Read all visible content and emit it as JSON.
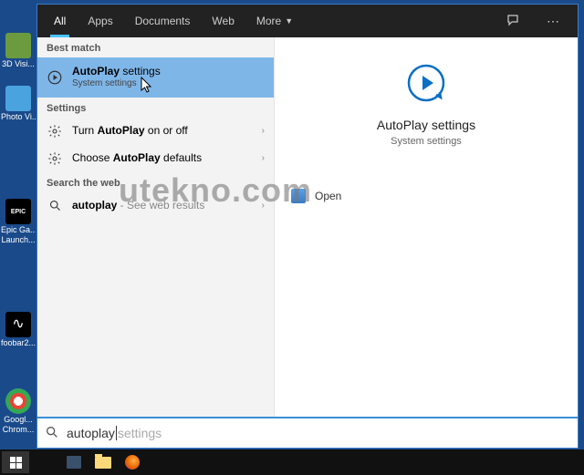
{
  "desktop": {
    "icons": [
      {
        "label": "3D Visi..."
      },
      {
        "label": "Photo Vi..."
      },
      {
        "label": "Epic Ga..."
      },
      {
        "label": "Launch..."
      },
      {
        "label": "foobar2..."
      },
      {
        "label": "Googl..."
      },
      {
        "label": "Chrom..."
      }
    ],
    "eg_text": "EPIC"
  },
  "tabs": {
    "items": [
      "All",
      "Apps",
      "Documents",
      "Web",
      "More"
    ],
    "active_index": 0
  },
  "left": {
    "best_match_hdr": "Best match",
    "best_match": {
      "line1_pre": "AutoPlay",
      "line1_post": " settings",
      "sub": "System settings"
    },
    "settings_hdr": "Settings",
    "settings": [
      {
        "pre": "Turn ",
        "bold": "AutoPlay",
        "post": " on or off"
      },
      {
        "pre": "Choose ",
        "bold": "AutoPlay",
        "post": " defaults"
      }
    ],
    "web_hdr": "Search the web",
    "web": {
      "bold": "autoplay",
      "post": " - See web results"
    }
  },
  "right": {
    "title": "AutoPlay settings",
    "subtitle": "System settings",
    "open": "Open"
  },
  "search": {
    "typed": "autoplay",
    "suggestion": " settings"
  },
  "watermark": "utekno.com"
}
